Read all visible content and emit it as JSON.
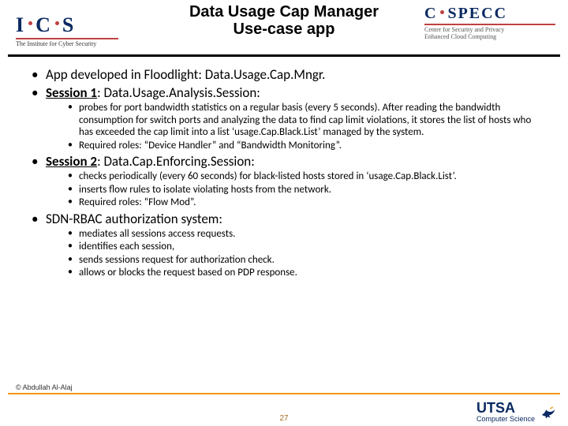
{
  "colors": {
    "accent_orange": "#f3960b",
    "navy": "#0b2a63",
    "red": "#c04040"
  },
  "header": {
    "title_line1": "Data Usage Cap Manager",
    "title_line2": "Use-case app",
    "logo_left": {
      "text": "I·C·S",
      "subtitle": "The Institute for Cyber Security"
    },
    "logo_right": {
      "text": "C·SPECC",
      "subtitle1": "Center for Security and Privacy",
      "subtitle2": "Enhanced Cloud Computing"
    }
  },
  "bullets": [
    {
      "text": "App developed in Floodlight: Data.Usage.Cap.Mngr."
    },
    {
      "html_prefix": "Session 1",
      "html_rest": ": Data.Usage.Analysis.Session:",
      "underline_prefix": true,
      "sub": [
        "probes for port bandwidth statistics on a regular basis (every 5 seconds). After reading the bandwidth consumption for switch ports and analyzing the data to find cap limit violations, it stores the list of hosts who has exceeded the cap limit into a list ‘usage.Cap.Black.List’ managed by the system.",
        "Required roles: “Device Handler” and “Bandwidth Monitoring”."
      ]
    },
    {
      "html_prefix": "Session 2",
      "html_rest": ": Data.Cap.Enforcing.Session:",
      "underline_prefix": true,
      "sub": [
        "checks periodically (every 60 seconds) for black-listed hosts stored in ‘usage.Cap.Black.List’.",
        "inserts flow rules to isolate violating hosts from the network.",
        "Required roles: “Flow Mod”."
      ]
    },
    {
      "text": "SDN-RBAC authorization system:",
      "sub": [
        "mediates all sessions access requests.",
        "identifies each session,",
        "sends sessions request for authorization check.",
        "allows or blocks the request based on PDP response."
      ]
    }
  ],
  "footer": {
    "author": "© Abdullah Al-Alaj",
    "page": "27",
    "utsa": "UTSA",
    "utsa_sub": "Computer Science"
  }
}
